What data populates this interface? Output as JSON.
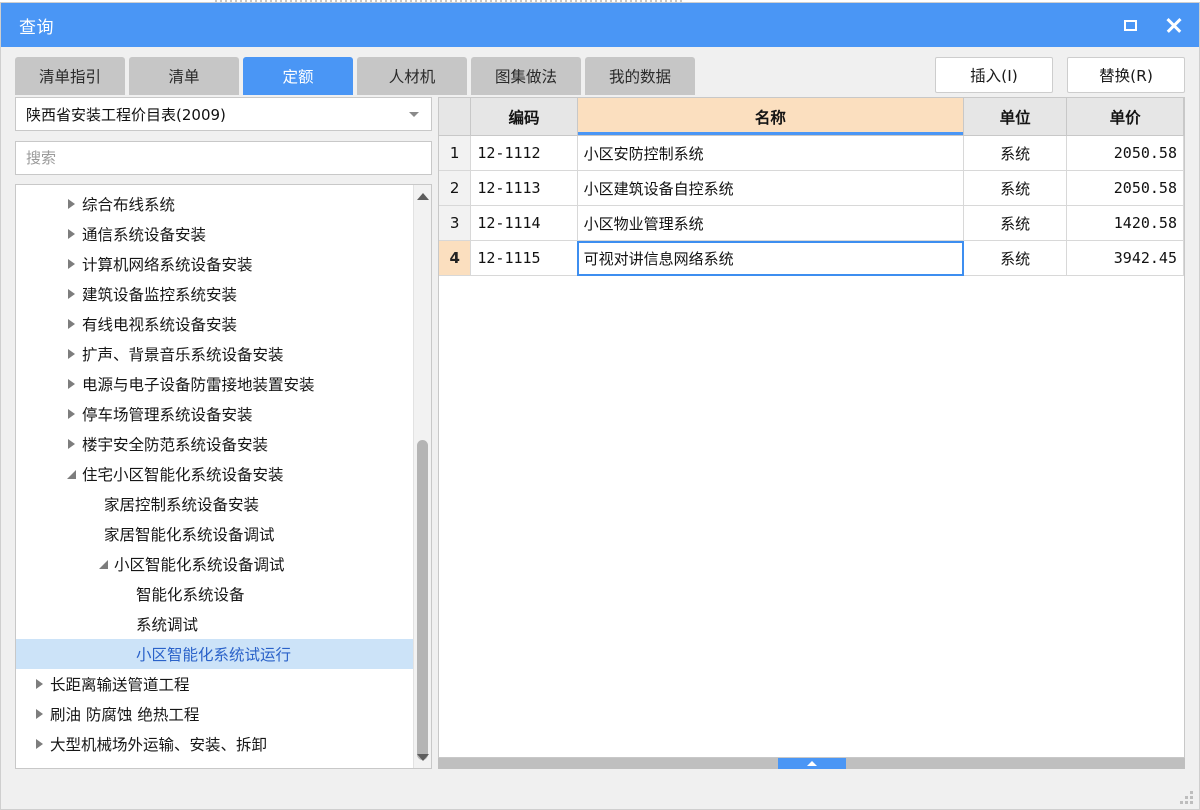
{
  "window": {
    "title": "查询",
    "controls": {
      "maximize": "□",
      "close": "✕"
    }
  },
  "tabs": [
    {
      "label": "清单指引",
      "active": false
    },
    {
      "label": "清单",
      "active": false
    },
    {
      "label": "定额",
      "active": true
    },
    {
      "label": "人材机",
      "active": false
    },
    {
      "label": "图集做法",
      "active": false
    },
    {
      "label": "我的数据",
      "active": false
    }
  ],
  "actions": {
    "insert_label": "插入(I)",
    "replace_label": "替换(R)"
  },
  "left_pane": {
    "catalog_select": {
      "value": "陕西省安装工程价目表(2009)"
    },
    "search": {
      "value": "",
      "placeholder": "搜索"
    },
    "tree": [
      {
        "label": "综合布线系统",
        "level": 1,
        "state": "collapsed",
        "selected": false
      },
      {
        "label": "通信系统设备安装",
        "level": 1,
        "state": "collapsed",
        "selected": false
      },
      {
        "label": "计算机网络系统设备安装",
        "level": 1,
        "state": "collapsed",
        "selected": false
      },
      {
        "label": "建筑设备监控系统安装",
        "level": 1,
        "state": "collapsed",
        "selected": false
      },
      {
        "label": "有线电视系统设备安装",
        "level": 1,
        "state": "collapsed",
        "selected": false
      },
      {
        "label": "扩声、背景音乐系统设备安装",
        "level": 1,
        "state": "collapsed",
        "selected": false
      },
      {
        "label": "电源与电子设备防雷接地装置安装",
        "level": 1,
        "state": "collapsed",
        "selected": false
      },
      {
        "label": "停车场管理系统设备安装",
        "level": 1,
        "state": "collapsed",
        "selected": false
      },
      {
        "label": "楼宇安全防范系统设备安装",
        "level": 1,
        "state": "collapsed",
        "selected": false
      },
      {
        "label": "住宅小区智能化系统设备安装",
        "level": 1,
        "state": "expanded",
        "selected": false
      },
      {
        "label": "家居控制系统设备安装",
        "level": 2,
        "state": "leaf",
        "selected": false
      },
      {
        "label": "家居智能化系统设备调试",
        "level": 2,
        "state": "leaf",
        "selected": false
      },
      {
        "label": "小区智能化系统设备调试",
        "level": 2,
        "state": "expanded",
        "selected": false
      },
      {
        "label": "智能化系统设备",
        "level": 3,
        "state": "leaf",
        "selected": false
      },
      {
        "label": "系统调试",
        "level": 3,
        "state": "leaf",
        "selected": false
      },
      {
        "label": "小区智能化系统试运行",
        "level": 3,
        "state": "leaf",
        "selected": true
      },
      {
        "label": "长距离输送管道工程",
        "level": 0,
        "state": "collapsed",
        "selected": false
      },
      {
        "label": "刷油 防腐蚀 绝热工程",
        "level": 0,
        "state": "collapsed",
        "selected": false
      },
      {
        "label": "大型机械场外运输、安装、拆卸",
        "level": 0,
        "state": "collapsed",
        "selected": false
      }
    ]
  },
  "grid": {
    "columns": [
      {
        "key": "rownum",
        "label": ""
      },
      {
        "key": "code",
        "label": "编码"
      },
      {
        "key": "name",
        "label": "名称"
      },
      {
        "key": "unit",
        "label": "单位"
      },
      {
        "key": "price",
        "label": "单价"
      }
    ],
    "rows": [
      {
        "rownum": "1",
        "code": "12-1112",
        "name": "小区安防控制系统",
        "unit": "系统",
        "price": "2050.58",
        "selected": false
      },
      {
        "rownum": "2",
        "code": "12-1113",
        "name": "小区建筑设备自控系统",
        "unit": "系统",
        "price": "2050.58",
        "selected": false
      },
      {
        "rownum": "3",
        "code": "12-1114",
        "name": "小区物业管理系统",
        "unit": "系统",
        "price": "1420.58",
        "selected": false
      },
      {
        "rownum": "4",
        "code": "12-1115",
        "name": "可视对讲信息网络系统",
        "unit": "系统",
        "price": "3942.45",
        "selected": true
      }
    ]
  },
  "colors": {
    "accent": "#4a96f5",
    "tab_inactive": "#c6c6c6",
    "name_header": "#fbdfbf",
    "tree_selected": "#cce3f8"
  }
}
